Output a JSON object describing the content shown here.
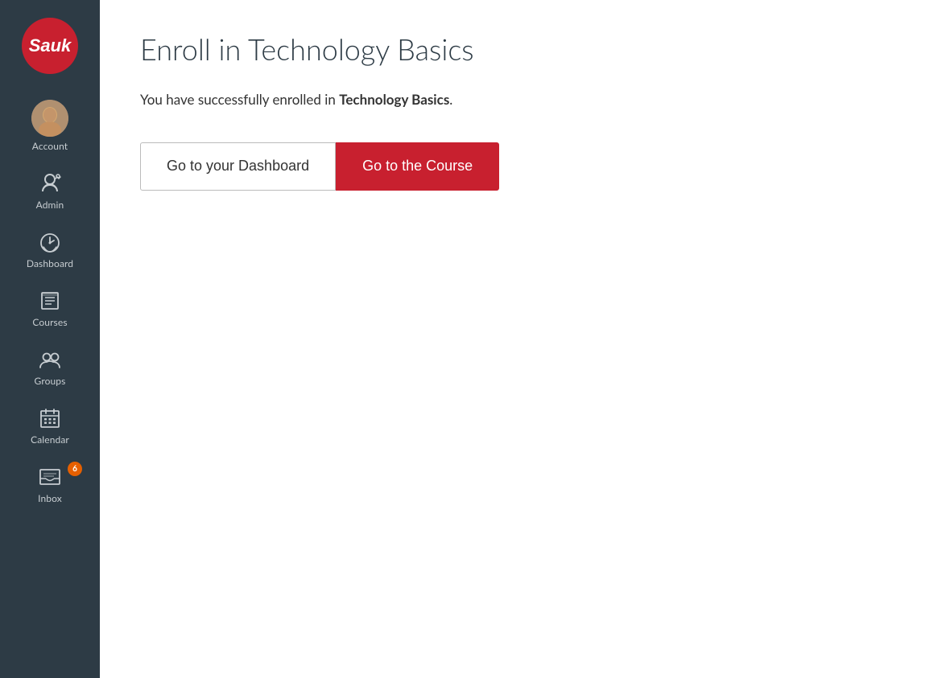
{
  "sidebar": {
    "logo_text": "Sauk",
    "items": [
      {
        "id": "account",
        "label": "Account",
        "icon": "account-icon"
      },
      {
        "id": "admin",
        "label": "Admin",
        "icon": "admin-icon"
      },
      {
        "id": "dashboard",
        "label": "Dashboard",
        "icon": "dashboard-icon"
      },
      {
        "id": "courses",
        "label": "Courses",
        "icon": "courses-icon"
      },
      {
        "id": "groups",
        "label": "Groups",
        "icon": "groups-icon"
      },
      {
        "id": "calendar",
        "label": "Calendar",
        "icon": "calendar-icon"
      },
      {
        "id": "inbox",
        "label": "Inbox",
        "icon": "inbox-icon",
        "badge": "6"
      }
    ]
  },
  "main": {
    "page_title": "Enroll in Technology Basics",
    "success_message_prefix": "You have successfully enrolled in ",
    "course_name": "Technology Basics",
    "success_message_suffix": ".",
    "btn_dashboard_label": "Go to your Dashboard",
    "btn_course_label": "Go to the Course"
  }
}
